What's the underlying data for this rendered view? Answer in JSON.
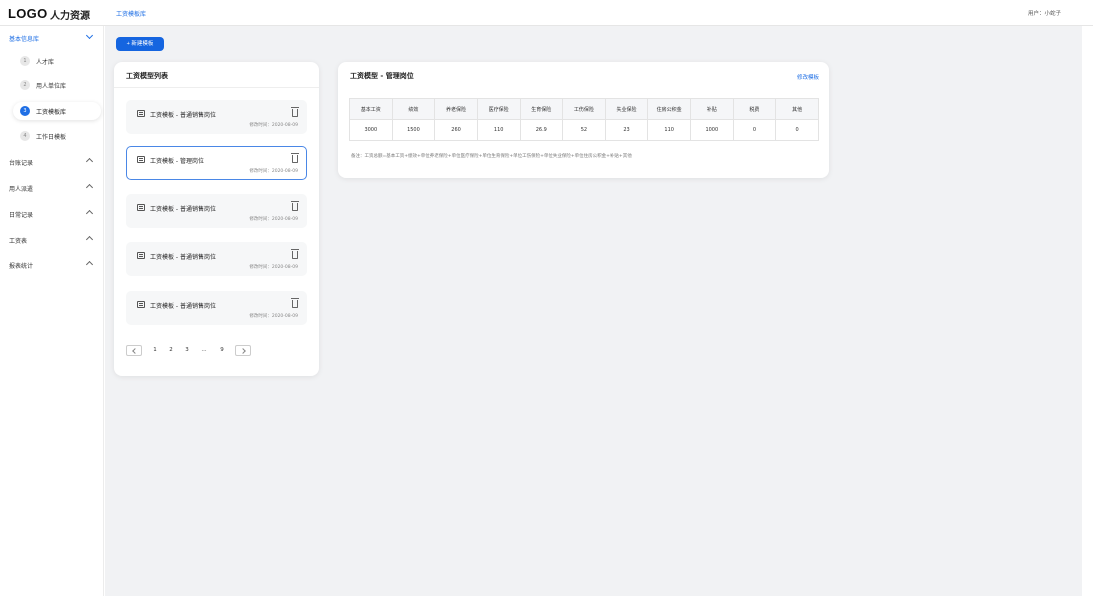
{
  "header": {
    "logo": "LOGO",
    "app_title": "人力资源",
    "breadcrumb": "工资模板库",
    "user": "用户：小蛇子"
  },
  "sidebar": {
    "groups": [
      {
        "label": "基本信息库"
      },
      {
        "label": "台账记录"
      },
      {
        "label": "用人派遣"
      },
      {
        "label": "日常记录"
      },
      {
        "label": "工资表"
      },
      {
        "label": "报表统计"
      }
    ],
    "sub_items": [
      {
        "num": "1",
        "label": "人才库"
      },
      {
        "num": "2",
        "label": "用人单位库"
      },
      {
        "num": "3",
        "label": "工资模板库"
      },
      {
        "num": "4",
        "label": "工作日模板"
      }
    ]
  },
  "toolbar": {
    "new_label": "+ 新建模板"
  },
  "list": {
    "title": "工资模型列表",
    "items": [
      {
        "name": "工资模板 - 普通销售岗位",
        "time": "修改时间：2020-08-09"
      },
      {
        "name": "工资模板 - 管理岗位",
        "time": "修改时间：2020-08-09"
      },
      {
        "name": "工资模板 - 普通销售岗位",
        "time": "修改时间：2020-08-09"
      },
      {
        "name": "工资模板 - 普通销售岗位",
        "time": "修改时间：2020-08-09"
      },
      {
        "name": "工资模板 - 普通销售岗位",
        "time": "修改时间：2020-08-09"
      }
    ],
    "pagination": [
      "1",
      "2",
      "3",
      "...",
      "9"
    ]
  },
  "detail": {
    "title": "工资模型 - 管理岗位",
    "edit_label": "修改模板",
    "columns": [
      "基本工资",
      "绩效",
      "养老保险",
      "医疗保险",
      "生育保险",
      "工伤保险",
      "失业保险",
      "住房公积金",
      "补贴",
      "税费",
      "其他"
    ],
    "values": [
      "3000",
      "1500",
      "260",
      "110",
      "26.9",
      "52",
      "23",
      "110",
      "1000",
      "0",
      "0"
    ],
    "remark": "备注：工资总额=基本工资+绩效+单位养老保险+单位医疗保险+单位生育保险+单位工伤保险+单位失业保险+单位住房公积金+补贴+其他"
  },
  "colors": {
    "accent": "#1f6fe5",
    "button": "#1565e0",
    "main_bg": "#f1f2f4"
  }
}
